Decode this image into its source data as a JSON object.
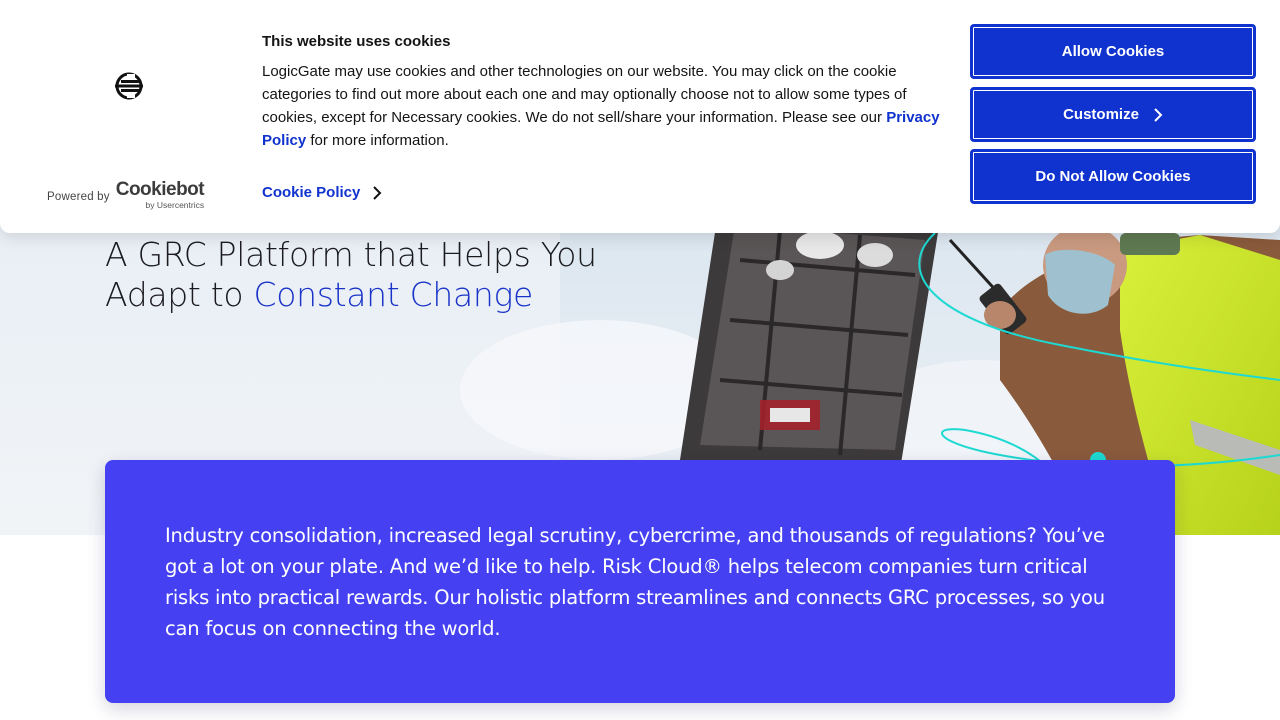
{
  "hero": {
    "heading_line1": "A GRC Platform that Helps You",
    "heading_line2_prefix": "Adapt to ",
    "heading_line2_accent": "Constant Change"
  },
  "info_card": {
    "text": "Industry consolidation, increased legal scrutiny, cybercrime, and thousands of regulations? You’ve got a lot on your plate. And we’d like to help. Risk Cloud® helps telecom companies turn critical risks into practical rewards. Our holistic platform streamlines and connects GRC processes, so you can focus on connecting the world."
  },
  "cookie_banner": {
    "title": "This website uses cookies",
    "body_before_link": "LogicGate may use cookies and other technologies on our website. You may click on the cookie categories to find out more about each one and may optionally choose not to allow some types of cookies, except for Necessary cookies.  We do not sell/share your information. Please see our ",
    "privacy_link": "Privacy Policy",
    "body_after_link": " for more information.",
    "cookie_policy_link": "Cookie Policy",
    "powered_by": "Powered by",
    "cookiebot_name": "Cookiebot",
    "cookiebot_sub": "by Usercentrics",
    "buttons": {
      "allow": "Allow Cookies",
      "customize": "Customize",
      "deny": "Do Not Allow Cookies"
    }
  },
  "colors": {
    "primary_button": "#1032cf",
    "accent_text": "#1a33c8",
    "card_background": "#4541f2",
    "swoosh_line": "#1ed9d2"
  },
  "icons": [
    "logicgate-logo-icon",
    "chevron-right-icon"
  ]
}
